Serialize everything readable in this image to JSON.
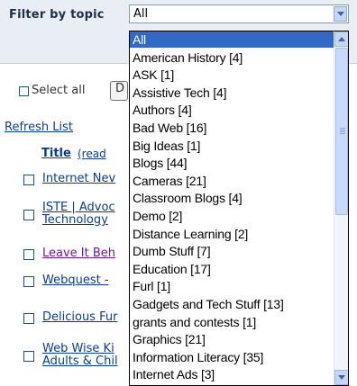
{
  "filter": {
    "label": "Filter by topic",
    "selected": "All"
  },
  "toolbar": {
    "select_all_label": "Select all",
    "button_partial": "D"
  },
  "list": {
    "refresh_label": "Refresh List",
    "title_header": "Title",
    "read_header": "(read"
  },
  "rows": [
    {
      "line1": "Internet Nev",
      "line2": "",
      "visited": false
    },
    {
      "line1": "ISTE | Advoc",
      "line2": "Technology",
      "visited": false
    },
    {
      "line1": "Leave It Beh",
      "line2": "",
      "visited": true
    },
    {
      "line1": "Webquest -",
      "line2": "",
      "visited": false
    },
    {
      "line1": "Delicious Fur",
      "line2": "",
      "visited": false
    },
    {
      "line1": "Web Wise Ki",
      "line2": "Adults & Chil",
      "visited": false
    }
  ],
  "dropdown": {
    "options": [
      "All",
      "American History [4]",
      "ASK [1]",
      "Assistive Tech [4]",
      "Authors [4]",
      "Bad Web [16]",
      "Big Ideas [1]",
      "Blogs [44]",
      "Cameras [21]",
      "Classroom Blogs [4]",
      "Demo [2]",
      "Distance Learning [2]",
      "Dumb Stuff [7]",
      "Education [17]",
      "Furl [1]",
      "Gadgets and Tech Stuff [13]",
      "grants and contests [1]",
      "Graphics [21]",
      "Information Literacy [35]",
      "Internet Ads [3]"
    ],
    "selected_index": 0
  }
}
